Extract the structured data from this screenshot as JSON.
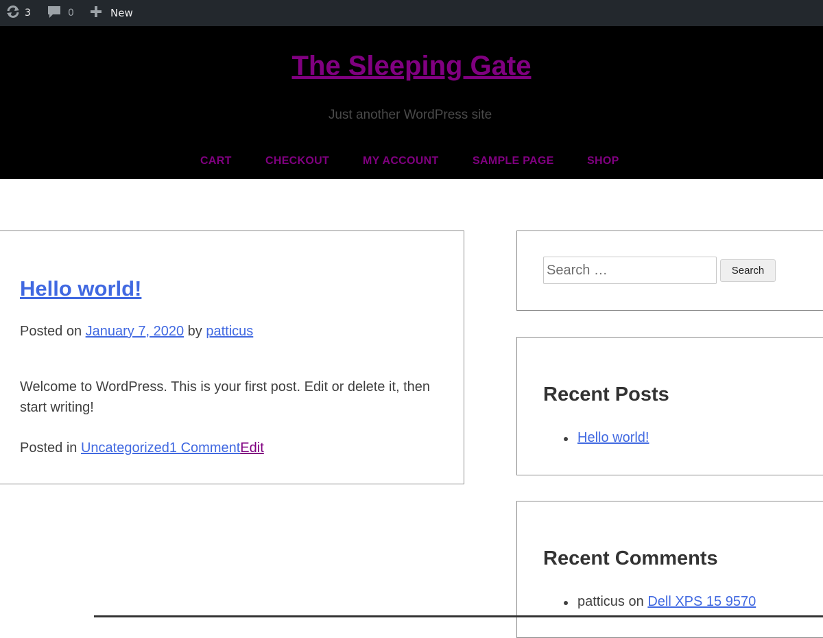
{
  "admin_bar": {
    "updates_count": "3",
    "comments_count": "0",
    "new_label": "New",
    "bg_color": "#23282d",
    "icons": [
      "updates-icon",
      "comment-bubble-icon",
      "plus-icon"
    ]
  },
  "header": {
    "site_title": "The Sleeping Gate",
    "tagline": "Just another WordPress site",
    "bg_color": "#000000",
    "link_color": "#800080",
    "nav": [
      "CART",
      "CHECKOUT",
      "MY ACCOUNT",
      "SAMPLE PAGE",
      "SHOP"
    ]
  },
  "post": {
    "title": "Hello world!",
    "posted_on_prefix": "Posted on",
    "date": "January 7, 2020",
    "by": "by",
    "author": "patticus",
    "content": "Welcome to WordPress. This is your first post. Edit or delete it, then start writing!",
    "posted_in_prefix": "Posted in",
    "category": "Uncategorized",
    "comments_link": "1 Comment",
    "edit_link": "Edit",
    "link_color": "#4169e1"
  },
  "sidebar": {
    "search": {
      "placeholder": "Search …",
      "button_label": "Search"
    },
    "recent_posts": {
      "title": "Recent Posts",
      "items": [
        "Hello world!"
      ]
    },
    "recent_comments": {
      "title": "Recent Comments",
      "items": [
        {
          "author": "patticus",
          "on": "on",
          "post": "Dell XPS 15 9570"
        }
      ]
    }
  }
}
